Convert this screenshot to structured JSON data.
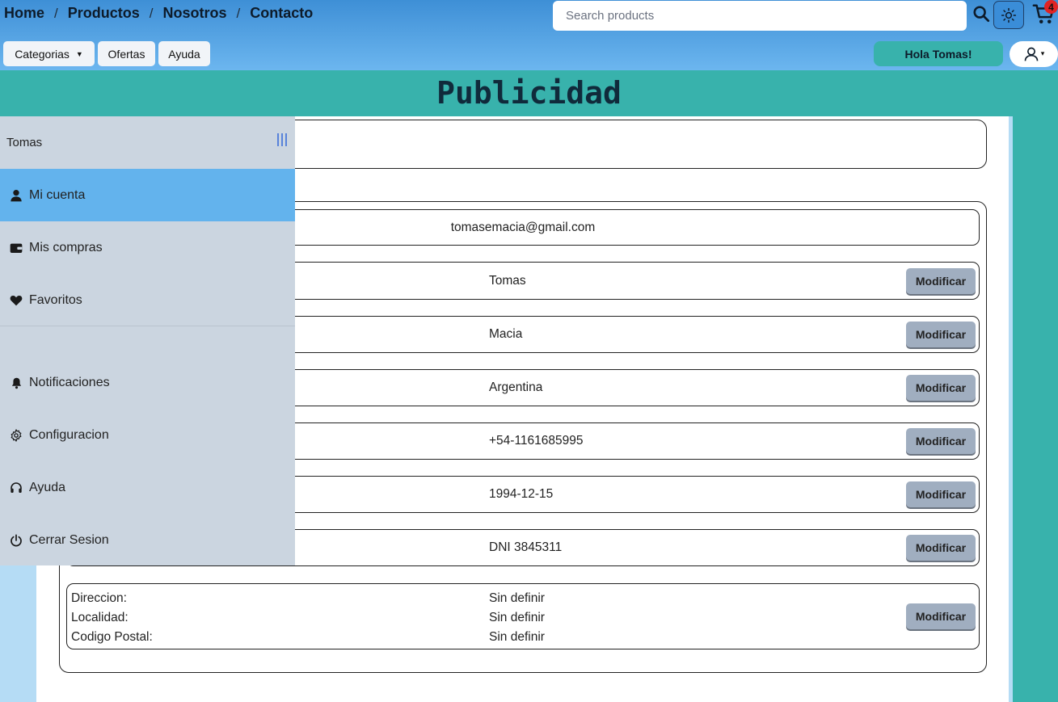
{
  "header": {
    "breadcrumb": [
      "Home",
      "Productos",
      "Nosotros",
      "Contacto"
    ],
    "breadcrumb_sep": "/",
    "search_placeholder": "Search products",
    "cart_count": "4",
    "nav": {
      "categorias": "Categorias",
      "ofertas": "Ofertas",
      "ayuda": "Ayuda"
    },
    "greeting": "Hola Tomas!"
  },
  "banner": {
    "title": "Publicidad"
  },
  "sidebar": {
    "user_name": "Tomas",
    "items": [
      {
        "label": "Mi cuenta",
        "icon": "user-icon",
        "active": true
      },
      {
        "label": "Mis compras",
        "icon": "wallet-icon"
      },
      {
        "label": "Favoritos",
        "icon": "heart-icon"
      },
      {
        "label": "Notificaciones",
        "icon": "bell-icon"
      },
      {
        "label": "Configuracion",
        "icon": "gear-icon"
      },
      {
        "label": "Ayuda",
        "icon": "headset-icon"
      },
      {
        "label": "Cerrar Sesion",
        "icon": "power-icon"
      }
    ]
  },
  "account": {
    "email": "tomasemacia@gmail.com",
    "modify_label": "Modificar",
    "fields": [
      "Tomas",
      "Macia",
      "Argentina",
      "+54-1161685995",
      "1994-12-15",
      "DNI 3845311"
    ],
    "address": {
      "labels": [
        "Direccion:",
        "Localidad:",
        "Codigo Postal:"
      ],
      "values": [
        "Sin definir",
        "Sin definir",
        "Sin definir"
      ]
    }
  },
  "colors": {
    "header_top": "#3e8fd6",
    "header_bottom": "#6cb6ef",
    "teal": "#38b2ac",
    "sidebar_bg": "#cbd5e0",
    "sidebar_active": "#63b3ed",
    "modify_button": "#a0aec0",
    "badge": "#e02424"
  }
}
